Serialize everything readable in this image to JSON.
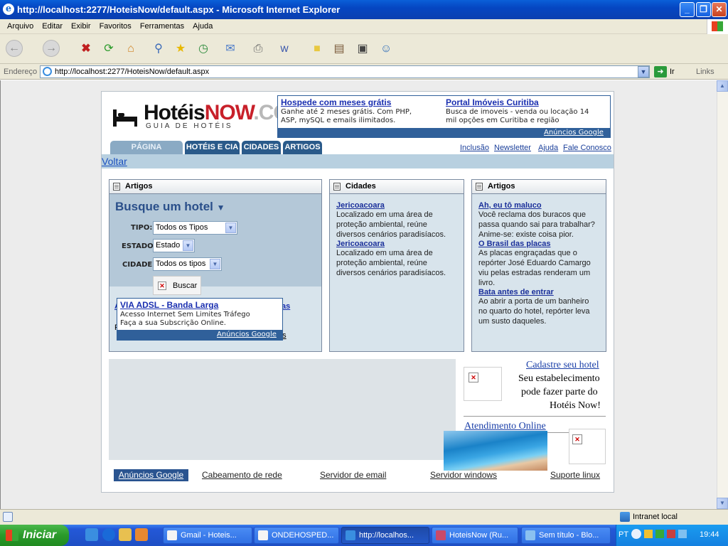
{
  "window": {
    "title": "http://localhost:2277/HoteisNow/default.aspx - Microsoft Internet Explorer"
  },
  "menu": [
    "Arquivo",
    "Editar",
    "Exibir",
    "Favoritos",
    "Ferramentas",
    "Ajuda"
  ],
  "address": {
    "label": "Endereço",
    "url": "http://localhost:2277/HoteisNow/default.aspx",
    "go": "Ir",
    "links": "Links"
  },
  "logo": {
    "hoteis": "Hotéis",
    "now": "NOW",
    "com": ".COM",
    "sub": "GUIA DE HOTÉIS"
  },
  "ad_top": {
    "ad1_title": "Hospede com meses grátis",
    "ad1_line1": "Ganhe até 2 meses grátis. Com PHP,",
    "ad1_line2": "ASP, mySQL e emails ilimitados.",
    "ad2_title": "Portal Imóveis Curitiba",
    "ad2_line1": "Busca de imoveis - venda ou locação 14",
    "ad2_line2": "mil opções em Curitiba e região",
    "footer": "Anúncios Google"
  },
  "tabs": [
    "PÁGINA PRINCIPAL",
    "HOTÉIS E CIA",
    "CIDADES",
    "ARTIGOS"
  ],
  "toplinks": [
    "Inclusão",
    "Newsletter",
    "Ajuda",
    "Fale Conosco"
  ],
  "voltar": "Voltar",
  "panel_search": {
    "title": "Artigos",
    "heading": "Busque um hotel",
    "tipo_label": "TIPO:",
    "tipo_value": "Todos os Tipos",
    "estado_label": "ESTADO:",
    "estado_value": "Estado",
    "cidade_label": "CIDADE:",
    "cidade_value": "Todos os tipos",
    "buscar": "Buscar"
  },
  "ad_mid": {
    "title": "VIA ADSL - Banda Larga",
    "line1": "Acesso Internet Sem Limites Tráfego",
    "line2": "Faça a sua Subscrição Online.",
    "footer": "Anúncios Google",
    "peek1": "A",
    "peek2": "as",
    "peek3": "F",
    "peek4": "es"
  },
  "panel_cidades": {
    "title": "Cidades",
    "items": [
      {
        "title": "Jericoacoara",
        "text": [
          "Localizado em uma área de",
          "proteção ambiental, reúne",
          "diversos cenários paradisíacos."
        ]
      },
      {
        "title": "Jericoacoara",
        "text": [
          "Localizado em uma área de",
          "proteção ambiental, reúne",
          "diversos cenários paradisíacos."
        ]
      }
    ]
  },
  "panel_artigos": {
    "title": "Artigos",
    "items": [
      {
        "title": "Ah, eu tô maluco",
        "text": [
          "Você reclama dos buracos que",
          "passa quando sai para trabalhar?",
          "Anime-se: existe coisa pior."
        ]
      },
      {
        "title": "O Brasil das placas",
        "text": [
          "As placas engraçadas que o",
          "repórter José Eduardo Camargo",
          "viu pelas estradas renderam um",
          "livro."
        ]
      },
      {
        "title": "Bata antes de entrar",
        "text": [
          "Ao abrir a porta de um banheiro",
          "no quarto do hotel, repórter leva",
          "um susto daqueles."
        ]
      }
    ]
  },
  "cadastre": {
    "link": "Cadastre seu hotel",
    "line1": "Seu estabelecimento",
    "line2": "pode fazer parte do",
    "line3": "Hotéis Now!"
  },
  "atendimento": "Atendimento Online",
  "footer_links": [
    "Anúncios Google",
    "Cabeamento de rede",
    "Servidor de email",
    "Servidor windows",
    "Suporte linux"
  ],
  "status": {
    "zone": "Intranet local"
  },
  "taskbar": {
    "start": "Iniciar",
    "buttons": [
      "Gmail - Hoteis...",
      "ONDEHOSPED...",
      "http://localhos...",
      "HoteisNow (Ru...",
      "Sem título - Blo..."
    ],
    "lang": "PT",
    "clock": "19:44"
  }
}
